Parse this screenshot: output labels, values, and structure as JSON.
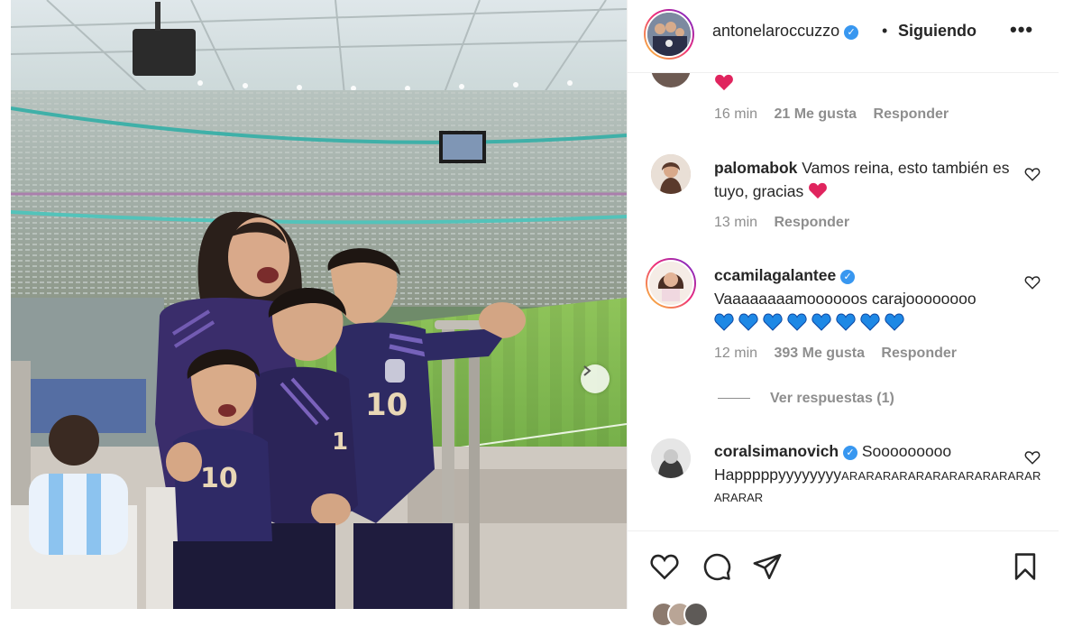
{
  "header": {
    "username": "antonelaroccuzzo",
    "separator": "•",
    "follow_label": "Siguiendo",
    "more_icon": "•••"
  },
  "comments": [
    {
      "username": "",
      "text": "",
      "emoji": "❤️",
      "time": "16 min",
      "likes": "21 Me gusta",
      "reply": "Responder"
    },
    {
      "username": "palomabok",
      "text": "Vamos reina, esto también es tuyo, gracias",
      "emoji": "❤️",
      "time": "13 min",
      "reply": "Responder"
    },
    {
      "username": "ccamilagalantee",
      "verified": true,
      "text": "Vaaaaaaaamoooooos carajoooooooo",
      "emoji": "💙💙💙💙💙💙💙💙",
      "time": "12 min",
      "likes": "393 Me gusta",
      "reply": "Responder",
      "view_replies": "Ver respuestas (1)"
    },
    {
      "username": "coralsimanovich",
      "verified": true,
      "text": "Sooooooooo",
      "text2": "Happpppyyyyyyyy",
      "text3": "ARARARARARARARARARARARAR",
      "text4": "ARARAR"
    }
  ],
  "actions": {
    "like_icon": "heart-icon",
    "comment_icon": "comment-icon",
    "share_icon": "paper-plane-icon",
    "save_icon": "bookmark-icon"
  },
  "colors": {
    "verified": "#3897f0",
    "heart": "#e0245e",
    "blue_heart": "#1e88e5",
    "muted": "#8e8e8e",
    "text": "#262626"
  }
}
